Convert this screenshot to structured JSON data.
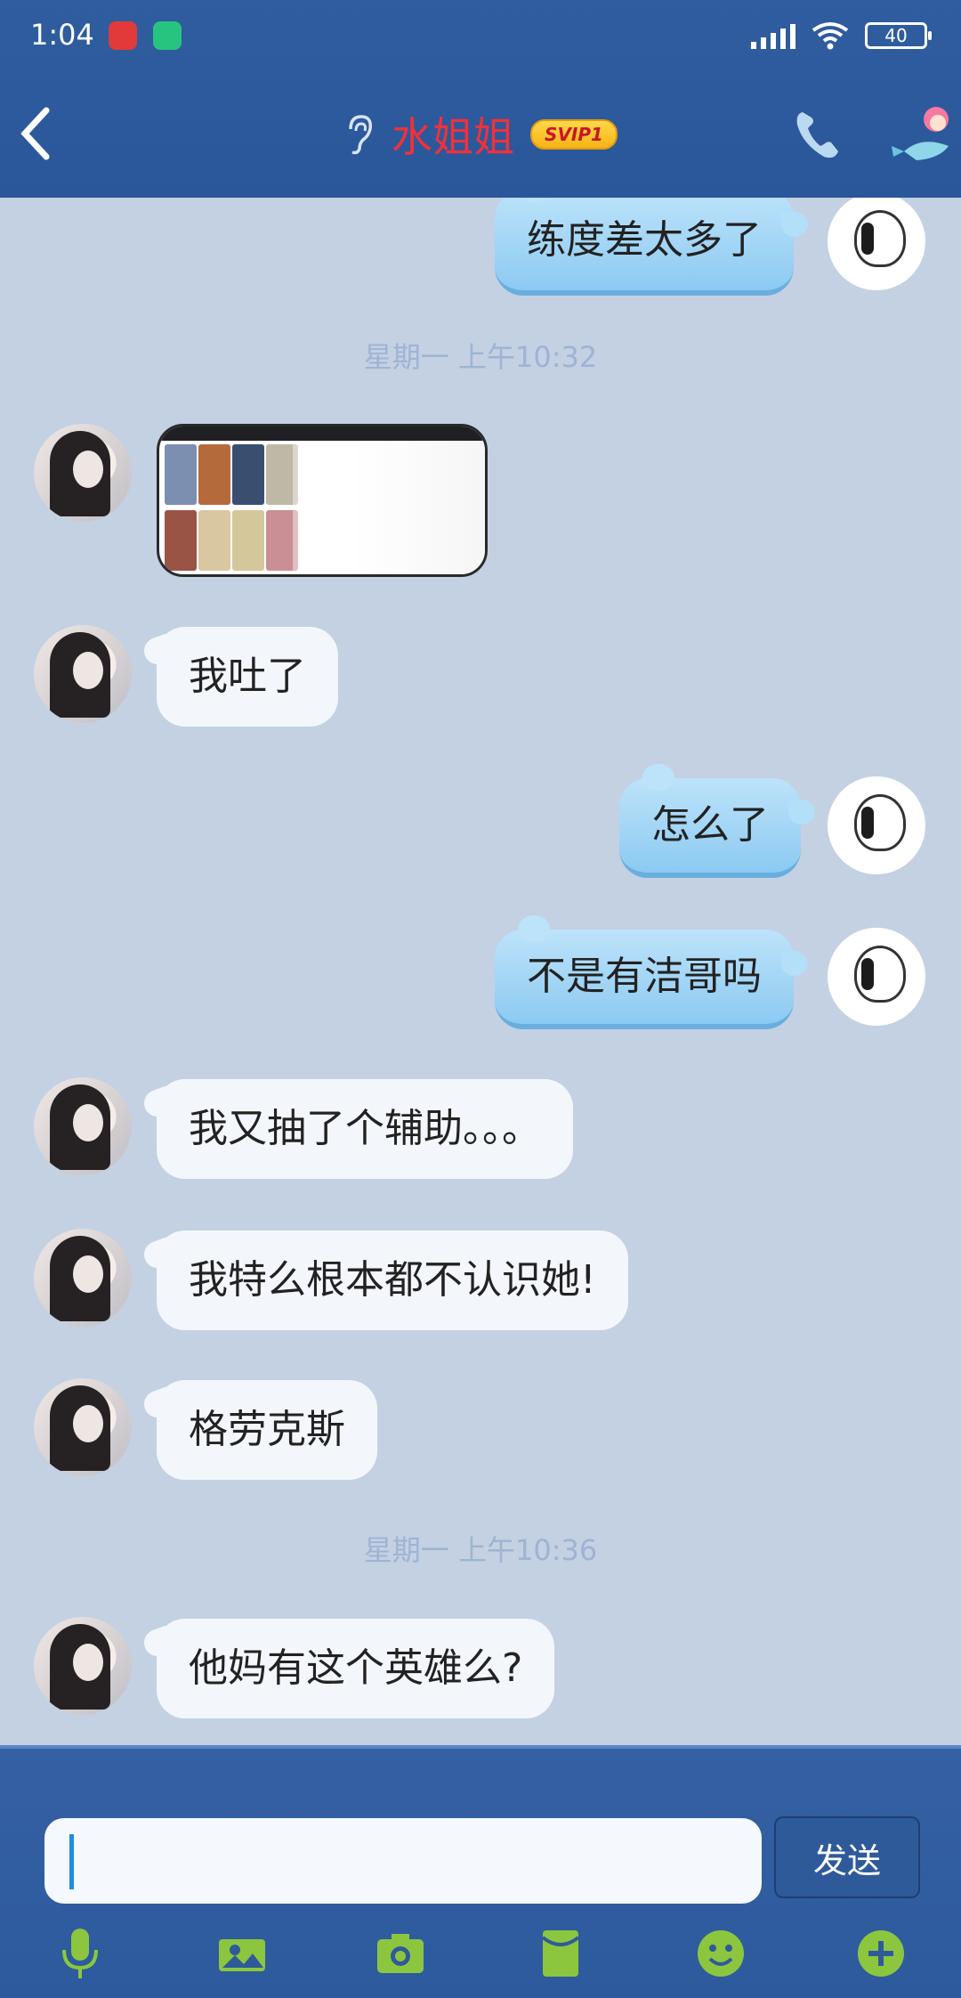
{
  "status_bar": {
    "time": "1:04",
    "battery": "40"
  },
  "header": {
    "title": "水姐姐",
    "badge": "SVIP1"
  },
  "messages": [
    {
      "side": "out",
      "text": "练度差太多了"
    },
    {
      "type": "time",
      "text": "星期一 上午10:32"
    },
    {
      "side": "in",
      "type": "image"
    },
    {
      "side": "in",
      "text": "我吐了"
    },
    {
      "side": "out",
      "text": "怎么了"
    },
    {
      "side": "out",
      "text": "不是有洁哥吗"
    },
    {
      "side": "in",
      "text": "我又抽了个辅助。。。"
    },
    {
      "side": "in",
      "text": "我特么根本都不认识她!"
    },
    {
      "side": "in",
      "text": "格劳克斯"
    },
    {
      "type": "time",
      "text": "星期一 上午10:36"
    },
    {
      "side": "in",
      "text": "他妈有这个英雄么?"
    }
  ],
  "input": {
    "value": "",
    "send_label": "发送"
  },
  "toolbar": {
    "icons": [
      "microphone-icon",
      "image-icon",
      "camera-icon",
      "red-packet-icon",
      "emoji-icon",
      "plus-icon"
    ],
    "accent": "#8cc63f"
  }
}
